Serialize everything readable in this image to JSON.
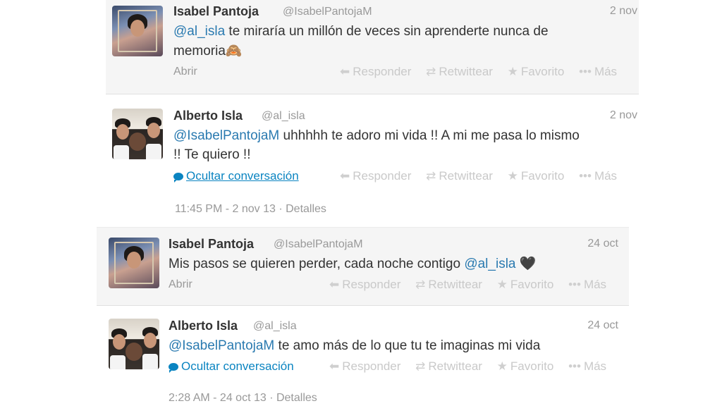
{
  "tweets": [
    {
      "name": "Isabel Pantoja",
      "handle": "@IsabelPantojaM",
      "date": "2 nov",
      "mention": "@al_isla",
      "text_after_mention": " te miraría un millón de veces sin aprenderte nunca de",
      "text_line2": "memoria🙈",
      "link": "Abrir",
      "actions": {
        "reply": "Responder",
        "retweet": "Retwittear",
        "favorite": "Favorito",
        "more": "Más"
      }
    },
    {
      "name": "Alberto Isla",
      "handle": "@al_isla",
      "date": "2 nov",
      "mention": "@IsabelPantojaM",
      "text_after_mention": " uhhhhh te adoro mi vida !! A mi me pasa lo mismo",
      "text_line2": "!! Te quiero !!",
      "link": "Ocultar conversación",
      "actions": {
        "reply": "Responder",
        "retweet": "Retwittear",
        "favorite": "Favorito",
        "more": "Más"
      },
      "meta": "11:45 PM - 2 nov 13 · Detalles"
    },
    {
      "name": "Isabel Pantoja",
      "handle": "@IsabelPantojaM",
      "date": "24 oct",
      "text_before_mention": "Mis pasos se quieren perder, cada noche contigo ",
      "mention": "@al_isla",
      "text_after_mention": " 🖤",
      "link": "Abrir",
      "actions": {
        "reply": "Responder",
        "retweet": "Retwittear",
        "favorite": "Favorito",
        "more": "Más"
      }
    },
    {
      "name": "Alberto Isla",
      "handle": "@al_isla",
      "date": "24 oct",
      "mention": "@IsabelPantojaM",
      "text_after_mention": " te amo más de lo que tu te imaginas mi vida",
      "link": "Ocultar conversación",
      "actions": {
        "reply": "Responder",
        "retweet": "Retwittear",
        "favorite": "Favorito",
        "more": "Más"
      },
      "meta": "2:28 AM - 24 oct 13 · Detalles"
    }
  ],
  "icons": {
    "reply": "reply-arrow-icon",
    "retweet": "retweet-icon",
    "favorite": "star-icon",
    "more": "more-dots-icon",
    "conversation": "speech-bubble-icon"
  },
  "colors": {
    "mention": "#2a7ab0",
    "link": "#0a84c1",
    "muted": "#999999",
    "row_bg": "#f5f5f5"
  }
}
